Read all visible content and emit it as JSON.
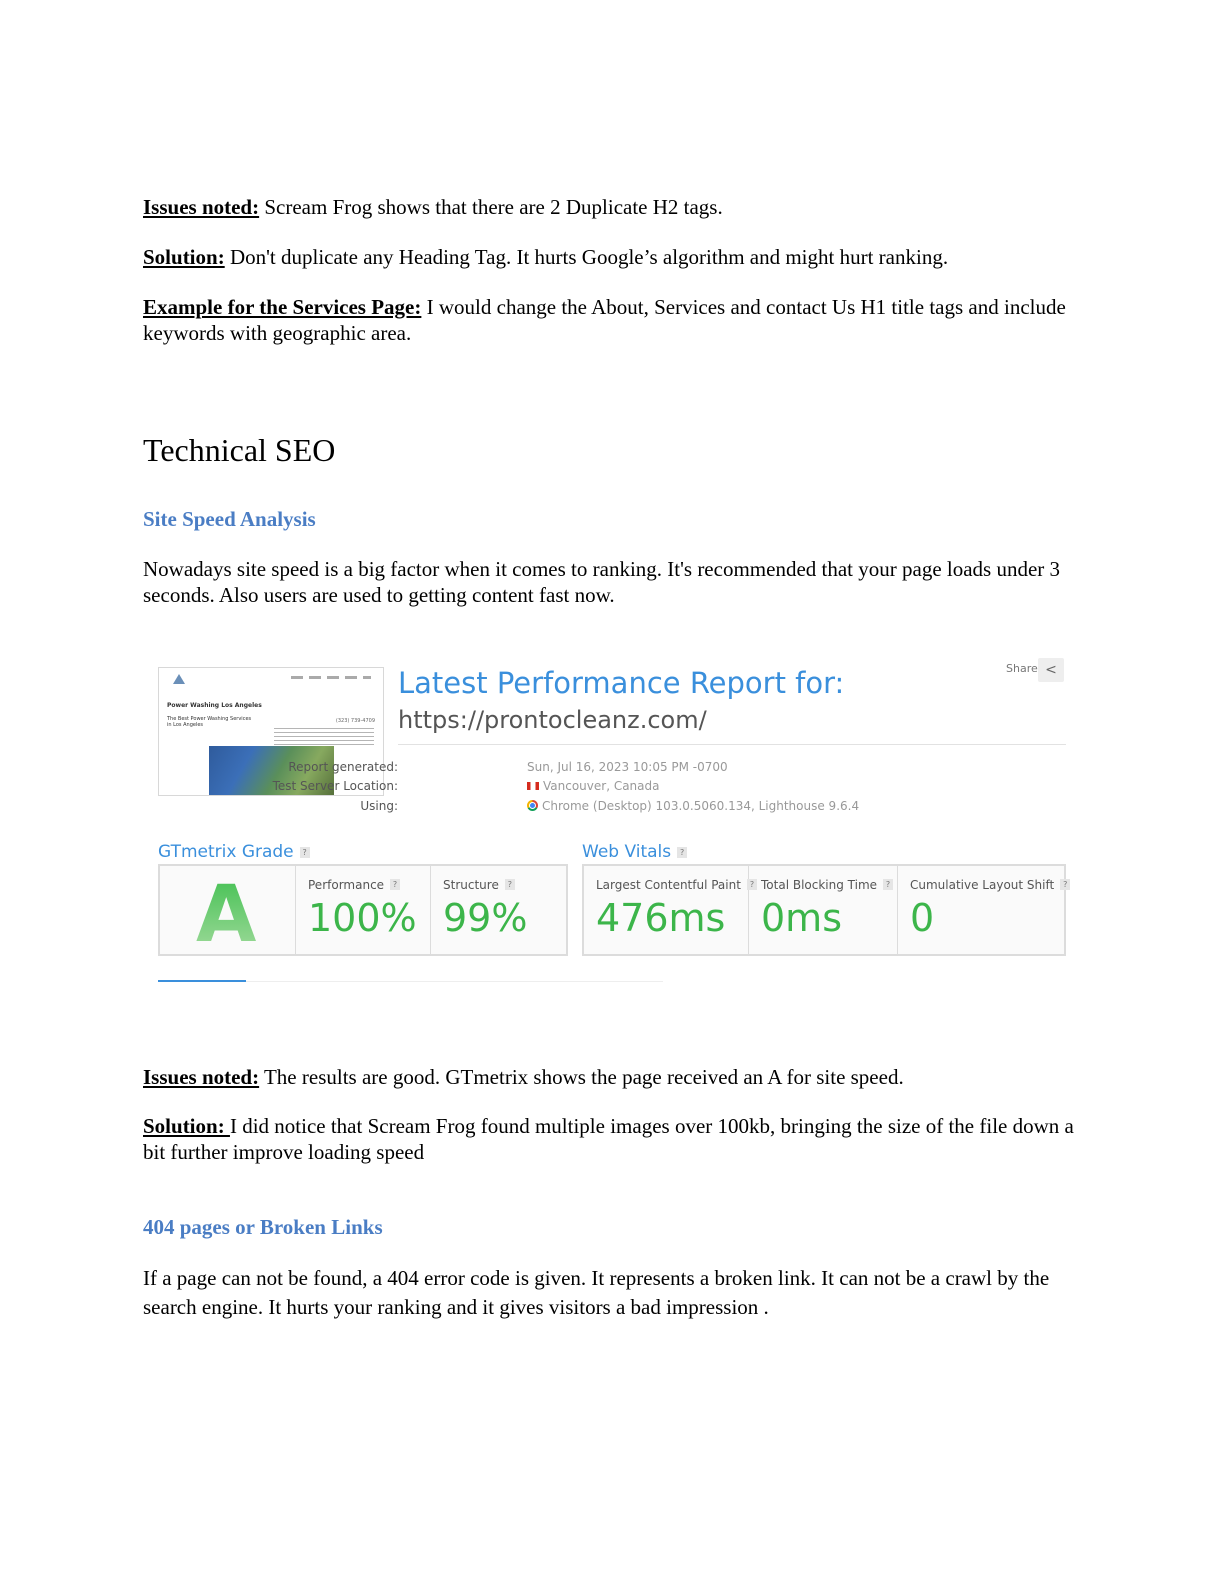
{
  "para1": {
    "label": "Issues noted:",
    "text": " Scream Frog shows that there are 2 Duplicate H2 tags."
  },
  "para2": {
    "label": "Solution:",
    "text": " Don't duplicate any Heading Tag. It hurts Google’s algorithm and might hurt ranking."
  },
  "para3": {
    "label": "Example for the Services Page:",
    "text": "  I would change the About, Services and contact Us H1 title tags and include keywords with geographic area."
  },
  "section_title": "Technical SEO",
  "speed_heading": "Site Speed Analysis",
  "speed_intro": "Nowadays site speed is a big factor when it comes to ranking. It's recommended that your page loads under 3 seconds. Also users are used to getting content fast now.",
  "report": {
    "thumb": {
      "site_title": "Power Washing Los Angeles",
      "site_sub": "The Best Power Washing Services in Los Angeles",
      "phone": "(323) 739-4709"
    },
    "title": "Latest Performance Report for:",
    "url": "https://prontocleanz.com/",
    "share": "Share",
    "share_icon": "share-icon",
    "meta": [
      {
        "key": "Report generated:",
        "value": "Sun, Jul 16, 2023 10:05 PM -0700"
      },
      {
        "key": "Test Server Location:",
        "value": "Vancouver, Canada"
      },
      {
        "key": "Using:",
        "value": "Chrome (Desktop) 103.0.5060.134, Lighthouse 9.6.4"
      }
    ],
    "grade_heading": "GTmetrix Grade",
    "grade": "A",
    "performance": {
      "label": "Performance",
      "value": "100%"
    },
    "structure": {
      "label": "Structure",
      "value": "99%"
    },
    "vitals_heading": "Web Vitals",
    "lcp": {
      "label": "Largest Contentful Paint",
      "value": "476ms"
    },
    "tbt": {
      "label": "Total Blocking Time",
      "value": "0ms"
    },
    "cls": {
      "label": "Cumulative Layout Shift",
      "value": "0"
    },
    "help": "?",
    "colors": {
      "accent": "#3a8fdc",
      "good": "#3cb54a"
    }
  },
  "para4": {
    "label": "Issues noted:",
    "text": " The results are good. GTmetrix shows the page received an A for site speed."
  },
  "para5": {
    "label": "Solution: ",
    "text": " I did notice that Scream Frog found multiple images over 100kb, bringing the size of the file down a bit further improve loading speed"
  },
  "broken_heading": "404 pages or Broken Links",
  "broken_text": "If a page can not be found, a 404 error code is given. It represents a broken link. It can not be a crawl by the search engine. It hurts your ranking and it gives visitors a bad impression ."
}
